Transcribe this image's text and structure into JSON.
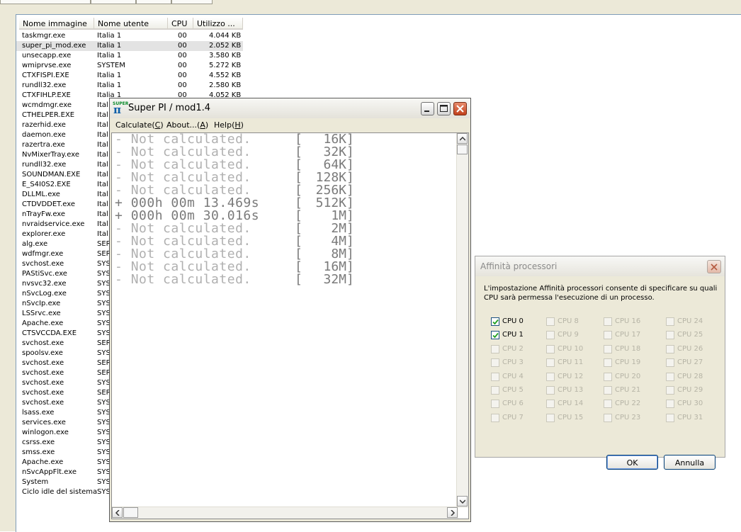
{
  "taskmanager": {
    "tabs": [],
    "columns": [
      "Nome immagine",
      "Nome utente",
      "CPU",
      "Utilizzo ..."
    ],
    "processes": [
      {
        "name": "taskmgr.exe",
        "user": "Italia 1",
        "cpu": "00",
        "mem": "4.044 KB"
      },
      {
        "name": "super_pi_mod.exe",
        "user": "Italia 1",
        "cpu": "00",
        "mem": "2.052 KB"
      },
      {
        "name": "unsecapp.exe",
        "user": "Italia 1",
        "cpu": "00",
        "mem": "3.580 KB"
      },
      {
        "name": "wmiprvse.exe",
        "user": "SYSTEM",
        "cpu": "00",
        "mem": "5.272 KB"
      },
      {
        "name": "CTXFISPI.EXE",
        "user": "Italia 1",
        "cpu": "00",
        "mem": "4.552 KB"
      },
      {
        "name": "rundll32.exe",
        "user": "Italia 1",
        "cpu": "00",
        "mem": "2.580 KB"
      },
      {
        "name": "CTXFIHLP.EXE",
        "user": "Italia 1",
        "cpu": "00",
        "mem": "4.052 KB"
      },
      {
        "name": "wcmdmgr.exe",
        "user": "Ital"
      },
      {
        "name": "CTHELPER.EXE",
        "user": "Ital"
      },
      {
        "name": "razerhid.exe",
        "user": "Ital"
      },
      {
        "name": "daemon.exe",
        "user": "Ital"
      },
      {
        "name": "razertra.exe",
        "user": "Ital"
      },
      {
        "name": "NvMixerTray.exe",
        "user": "Ital"
      },
      {
        "name": "rundll32.exe",
        "user": "Ital"
      },
      {
        "name": "SOUNDMAN.EXE",
        "user": "Ital"
      },
      {
        "name": "E_S4I0S2.EXE",
        "user": "Ital"
      },
      {
        "name": "DLLML.exe",
        "user": "Ital"
      },
      {
        "name": "CTDVDDET.exe",
        "user": "Ital"
      },
      {
        "name": "nTrayFw.exe",
        "user": "Ital"
      },
      {
        "name": "nvraidservice.exe",
        "user": "Ital"
      },
      {
        "name": "explorer.exe",
        "user": "Ital"
      },
      {
        "name": "alg.exe",
        "user": "SER"
      },
      {
        "name": "wdfmgr.exe",
        "user": "SER"
      },
      {
        "name": "svchost.exe",
        "user": "SYS"
      },
      {
        "name": "PAStiSvc.exe",
        "user": "SYS"
      },
      {
        "name": "nvsvc32.exe",
        "user": "SYS"
      },
      {
        "name": "nSvcLog.exe",
        "user": "SYS"
      },
      {
        "name": "nSvcIp.exe",
        "user": "SYS"
      },
      {
        "name": "LSSrvc.exe",
        "user": "SYS"
      },
      {
        "name": "Apache.exe",
        "user": "SYS"
      },
      {
        "name": "CTSVCCDA.EXE",
        "user": "SYS"
      },
      {
        "name": "svchost.exe",
        "user": "SER"
      },
      {
        "name": "spoolsv.exe",
        "user": "SYS"
      },
      {
        "name": "svchost.exe",
        "user": "SER"
      },
      {
        "name": "svchost.exe",
        "user": "SER"
      },
      {
        "name": "svchost.exe",
        "user": "SYS"
      },
      {
        "name": "svchost.exe",
        "user": "SER"
      },
      {
        "name": "svchost.exe",
        "user": "SYS"
      },
      {
        "name": "lsass.exe",
        "user": "SYS"
      },
      {
        "name": "services.exe",
        "user": "SYS"
      },
      {
        "name": "winlogon.exe",
        "user": "SYS"
      },
      {
        "name": "csrss.exe",
        "user": "SYS"
      },
      {
        "name": "smss.exe",
        "user": "SYS"
      },
      {
        "name": "Apache.exe",
        "user": "SYS"
      },
      {
        "name": "nSvcAppFlt.exe",
        "user": "SYS"
      },
      {
        "name": "System",
        "user": "SYS"
      },
      {
        "name": "Ciclo idle del sistema",
        "user": "SYS"
      }
    ]
  },
  "superpi": {
    "title": "Super PI / mod1.4",
    "icon_label": "SUPER",
    "icon_glyph": "π",
    "menu": [
      {
        "text": "Calculate(",
        "mnemonic": "C",
        "close": ")"
      },
      {
        "text": "About...(",
        "mnemonic": "A",
        "close": ")"
      },
      {
        "text": "Help(",
        "mnemonic": "H",
        "close": ")"
      }
    ],
    "results": [
      {
        "prefix": "-",
        "text": "Not calculated.",
        "size": "16K",
        "done": false
      },
      {
        "prefix": "-",
        "text": "Not calculated.",
        "size": "32K",
        "done": false
      },
      {
        "prefix": "-",
        "text": "Not calculated.",
        "size": "64K",
        "done": false
      },
      {
        "prefix": "-",
        "text": "Not calculated.",
        "size": "128K",
        "done": false
      },
      {
        "prefix": "-",
        "text": "Not calculated.",
        "size": "256K",
        "done": false
      },
      {
        "prefix": "+",
        "text": "000h 00m 13.469s",
        "size": "512K",
        "done": true
      },
      {
        "prefix": "+",
        "text": "000h 00m 30.016s",
        "size": "1M",
        "done": true
      },
      {
        "prefix": "-",
        "text": "Not calculated.",
        "size": "2M",
        "done": false
      },
      {
        "prefix": "-",
        "text": "Not calculated.",
        "size": "4M",
        "done": false
      },
      {
        "prefix": "-",
        "text": "Not calculated.",
        "size": "8M",
        "done": false
      },
      {
        "prefix": "-",
        "text": "Not calculated.",
        "size": "16M",
        "done": false
      },
      {
        "prefix": "-",
        "text": "Not calculated.",
        "size": "32M",
        "done": false
      }
    ]
  },
  "affinity": {
    "title": "Affinità processori",
    "description": "L'impostazione Affinità processori consente di specificare su quali CPU sarà permessa l'esecuzione di un processo.",
    "cpus": [
      {
        "label": "CPU 0",
        "checked": true,
        "enabled": true
      },
      {
        "label": "CPU 1",
        "checked": true,
        "enabled": true
      },
      {
        "label": "CPU 2"
      },
      {
        "label": "CPU 3"
      },
      {
        "label": "CPU 4"
      },
      {
        "label": "CPU 5"
      },
      {
        "label": "CPU 6"
      },
      {
        "label": "CPU 7"
      },
      {
        "label": "CPU 8"
      },
      {
        "label": "CPU 9"
      },
      {
        "label": "CPU 10"
      },
      {
        "label": "CPU 11"
      },
      {
        "label": "CPU 12"
      },
      {
        "label": "CPU 13"
      },
      {
        "label": "CPU 14"
      },
      {
        "label": "CPU 15"
      },
      {
        "label": "CPU 16"
      },
      {
        "label": "CPU 17"
      },
      {
        "label": "CPU 18"
      },
      {
        "label": "CPU 19"
      },
      {
        "label": "CPU 20"
      },
      {
        "label": "CPU 21"
      },
      {
        "label": "CPU 22"
      },
      {
        "label": "CPU 23"
      },
      {
        "label": "CPU 24"
      },
      {
        "label": "CPU 25"
      },
      {
        "label": "CPU 26"
      },
      {
        "label": "CPU 27"
      },
      {
        "label": "CPU 28"
      },
      {
        "label": "CPU 29"
      },
      {
        "label": "CPU 30"
      },
      {
        "label": "CPU 31"
      }
    ],
    "ok_label": "OK",
    "cancel_label": "Annulla"
  },
  "colors": {
    "selected_row": "#e3e3e3",
    "not_calculated": "#b0b0b0",
    "calculated": "#7a7a7a",
    "close_button": "#c1401c",
    "dialog_bg": "#ece9d8"
  }
}
